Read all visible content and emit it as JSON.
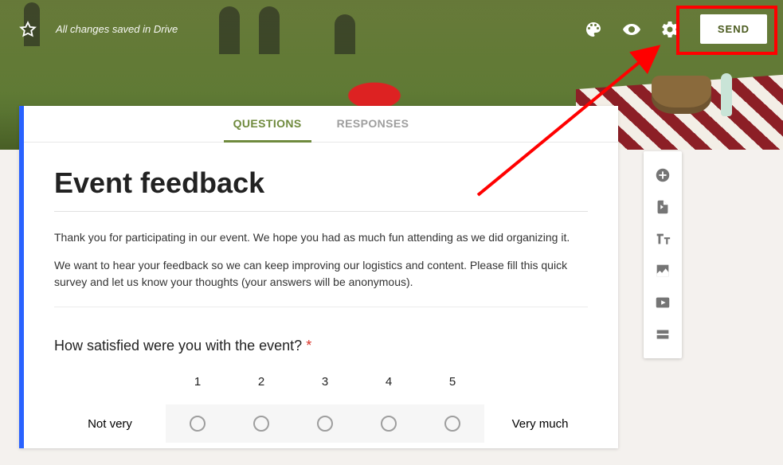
{
  "header": {
    "save_status": "All changes saved in Drive",
    "send_label": "SEND"
  },
  "tabs": {
    "questions": "QUESTIONS",
    "responses": "RESPONSES",
    "active": "questions"
  },
  "form": {
    "title": "Event feedback",
    "description_p1": "Thank you for participating in our event. We hope you had as much fun attending as we did organizing it.",
    "description_p2": "We want to hear your feedback so we can keep improving our logistics and content. Please fill this quick survey and let us know your thoughts (your answers will be anonymous).",
    "question1": {
      "text": "How satisfied were you with the event?",
      "required": true,
      "scale_low_label": "Not very",
      "scale_high_label": "Very much",
      "scale_points": [
        "1",
        "2",
        "3",
        "4",
        "5"
      ]
    }
  },
  "side_toolbar_icons": [
    "add-question-icon",
    "import-questions-icon",
    "add-title-icon",
    "add-image-icon",
    "add-video-icon",
    "add-section-icon"
  ],
  "colors": {
    "accent": "#6f8a3d",
    "highlight": "#ff0000"
  }
}
